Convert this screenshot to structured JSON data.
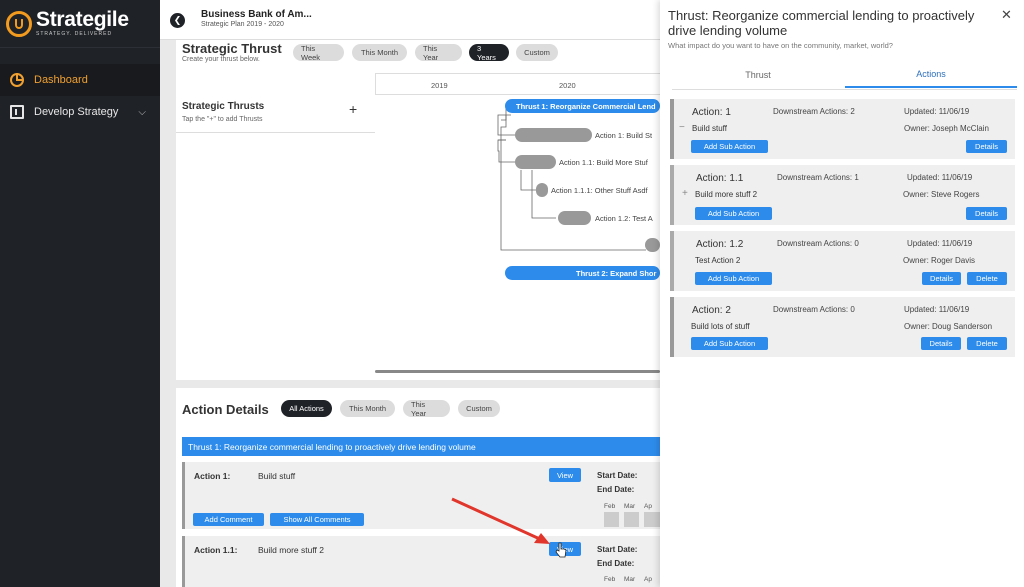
{
  "brand": {
    "name": "Strategile",
    "tagline": "STRATEGY. DELIVERED"
  },
  "sidebar": {
    "items": [
      {
        "label": "Dashboard",
        "icon": "pie-chart-icon",
        "active": true
      },
      {
        "label": "Develop Strategy",
        "icon": "board-icon",
        "active": false
      }
    ]
  },
  "header": {
    "org_name": "Business Bank of Am...",
    "plan": "Strategic Plan 2019 - 2020"
  },
  "thrust_panel": {
    "title": "Strategic Thrust",
    "subtitle": "Create your thrust below.",
    "filters": [
      "This Week",
      "This Month",
      "This Year",
      "3 Years",
      "Custom"
    ],
    "active_filter": "3 Years",
    "years": [
      "2019",
      "2020"
    ],
    "list_title": "Strategic Thrusts",
    "list_hint": "Tap the \"+\" to add Thrusts",
    "add_symbol": "+",
    "gantt": {
      "thrust1": "Thrust 1: Reorganize Commercial Lend",
      "a1": "Action 1: Build St",
      "a11": "Action 1.1: Build More Stuf",
      "a111": "Action 1.1.1: Other Stuff Asdf",
      "a12": "Action 1.2: Test A",
      "thrust2": "Thrust 2: Expand Shor"
    }
  },
  "action_details": {
    "title": "Action Details",
    "filters": [
      "All Actions",
      "This Month",
      "This Year",
      "Custom"
    ],
    "active_filter": "All Actions",
    "thrust_bar": "Thrust 1:   Reorganize commercial lending to proactively drive lending volume",
    "rows": [
      {
        "label": "Action 1:",
        "name": "Build stuff",
        "view": "View",
        "start_label": "Start Date:",
        "end_label": "End Date:",
        "add_comment": "Add Comment",
        "show_comments": "Show All Comments"
      },
      {
        "label": "Action 1.1:",
        "name": "Build more stuff 2",
        "view": "View",
        "start_label": "Start Date:",
        "end_label": "End Date:"
      }
    ],
    "months": [
      "Feb",
      "Mar",
      "Ap"
    ]
  },
  "overlay": {
    "title": "Thrust: Reorganize commercial lending to proactively drive lending volume",
    "subtitle": "What impact do you want to have on the community, market, world?",
    "close": "✕",
    "tabs": [
      "Thrust",
      "Actions"
    ],
    "active_tab": "Actions",
    "add_sub_label": "Add Sub Action",
    "details_label": "Details",
    "delete_label": "Delete",
    "cards": [
      {
        "label": "Action: 1",
        "downstream": "Downstream Actions: 2",
        "updated": "Updated: 11/06/19",
        "name": "Build stuff",
        "owner": "Owner: Joseph McClain",
        "toggle": "−"
      },
      {
        "label": "Action: 1.1",
        "downstream": "Downstream Actions: 1",
        "updated": "Updated: 11/06/19",
        "name": "Build more stuff 2",
        "owner": "Owner: Steve Rogers",
        "toggle": "+"
      },
      {
        "label": "Action: 1.2",
        "downstream": "Downstream Actions: 0",
        "updated": "Updated: 11/06/19",
        "name": "Test Action 2",
        "owner": "Owner: Roger Davis",
        "toggle": ""
      },
      {
        "label": "Action: 2",
        "downstream": "Downstream Actions: 0",
        "updated": "Updated: 11/06/19",
        "name": "Build lots of stuff",
        "owner": "Owner: Doug Sanderson",
        "toggle": ""
      }
    ]
  },
  "colors": {
    "accent": "#2d8ceb",
    "sidebar": "#1f2227",
    "brand_orange": "#f29b1e",
    "arrow": "#e0362c"
  }
}
